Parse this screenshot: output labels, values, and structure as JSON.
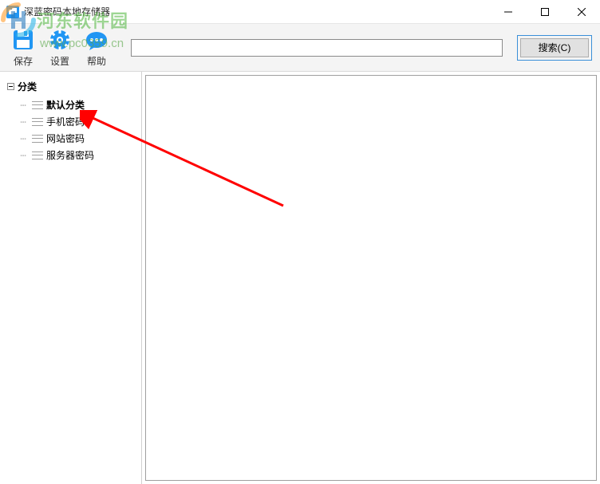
{
  "window": {
    "title": "深蓝密码本地存储器"
  },
  "toolbar": {
    "save_label": "保存",
    "settings_label": "设置",
    "help_label": "帮助"
  },
  "search": {
    "value": "",
    "placeholder": "",
    "button_label": "搜索(C)"
  },
  "tree": {
    "root_label": "分类",
    "items": [
      {
        "label": "默认分类",
        "bold": true
      },
      {
        "label": "手机密码",
        "bold": false
      },
      {
        "label": "网站密码",
        "bold": false
      },
      {
        "label": "服务器密码",
        "bold": false
      }
    ]
  },
  "watermark": {
    "brand": "河东软件园",
    "url": "www.pc0359.cn"
  },
  "colors": {
    "accent": "#2196f3",
    "watermark_green": "#5dbb4d",
    "arrow_red": "#ff0000"
  }
}
